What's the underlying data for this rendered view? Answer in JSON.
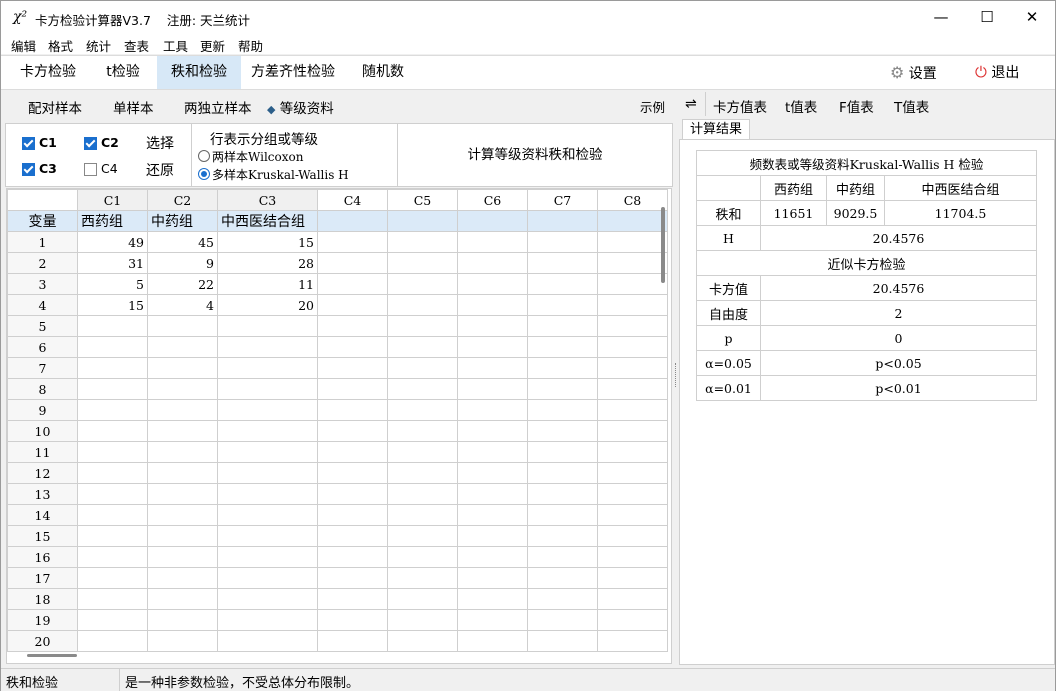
{
  "window": {
    "title": "卡方检验计算器V3.7",
    "registration": "注册: 天兰统计",
    "minimize": "—",
    "maximize": "☐",
    "close": "✕"
  },
  "menu": [
    "编辑",
    "格式",
    "统计",
    "查表",
    "工具",
    "更新",
    "帮助"
  ],
  "tabs": [
    {
      "label": "卡方检验",
      "active": false
    },
    {
      "label": "t检验",
      "active": false
    },
    {
      "label": "秩和检验",
      "active": true
    },
    {
      "label": "方差齐性检验",
      "active": false
    },
    {
      "label": "随机数",
      "active": false
    }
  ],
  "toolbar": {
    "settings": "设置",
    "exit": "退出"
  },
  "subtabs": [
    "配对样本",
    "单样本",
    "两独立样本",
    "等级资料"
  ],
  "example_label": "示例",
  "options": {
    "columns": [
      {
        "label": "C1",
        "checked": true
      },
      {
        "label": "C2",
        "checked": true
      },
      {
        "label": "C3",
        "checked": true
      },
      {
        "label": "C4",
        "checked": false
      }
    ],
    "select_label": "选择",
    "restore_label": "还原",
    "group_title": "行表示分组或等级",
    "radio_wilcoxon": "两样本Wilcoxon",
    "radio_kw": "多样本Kruskal-Wallis H",
    "compute_button": "计算等级资料秩和检验"
  },
  "grid": {
    "col_headers": [
      "C1",
      "C2",
      "C3",
      "C4",
      "C5",
      "C6",
      "C7",
      "C8"
    ],
    "var_label": "变量",
    "var_names": [
      "西药组",
      "中药组",
      "中西医结合组",
      "",
      "",
      "",
      "",
      ""
    ],
    "rows": [
      [
        "49",
        "45",
        "15"
      ],
      [
        "31",
        "9",
        "28"
      ],
      [
        "5",
        "22",
        "11"
      ],
      [
        "15",
        "4",
        "20"
      ]
    ],
    "row_numbers": [
      "1",
      "2",
      "3",
      "4",
      "5",
      "6",
      "7",
      "8",
      "9",
      "10",
      "11",
      "12",
      "13",
      "14",
      "15",
      "16",
      "17",
      "18",
      "19",
      "20"
    ]
  },
  "right_tabs": [
    "卡方值表",
    "t值表",
    "F值表",
    "T值表"
  ],
  "result_tab": "计算结果",
  "results": {
    "title": "频数表或等级资料Kruskal-Wallis H 检验",
    "groups": [
      "西药组",
      "中药组",
      "中西医结合组"
    ],
    "rank_label": "秩和",
    "rank_sums": [
      "11651",
      "9029.5",
      "11704.5"
    ],
    "h_label": "H",
    "h_value": "20.4576",
    "approx_title": "近似卡方检验",
    "chi_label": "卡方值",
    "chi_value": "20.4576",
    "df_label": "自由度",
    "df_value": "2",
    "p_label": "p",
    "p_value": "0",
    "a05_label": "α=0.05",
    "a05_value": "p<0.05",
    "a01_label": "α=0.01",
    "a01_value": "p<0.01"
  },
  "status": {
    "left": "秩和检验",
    "message": "是一种非参数检验，不受总体分布限制。"
  }
}
